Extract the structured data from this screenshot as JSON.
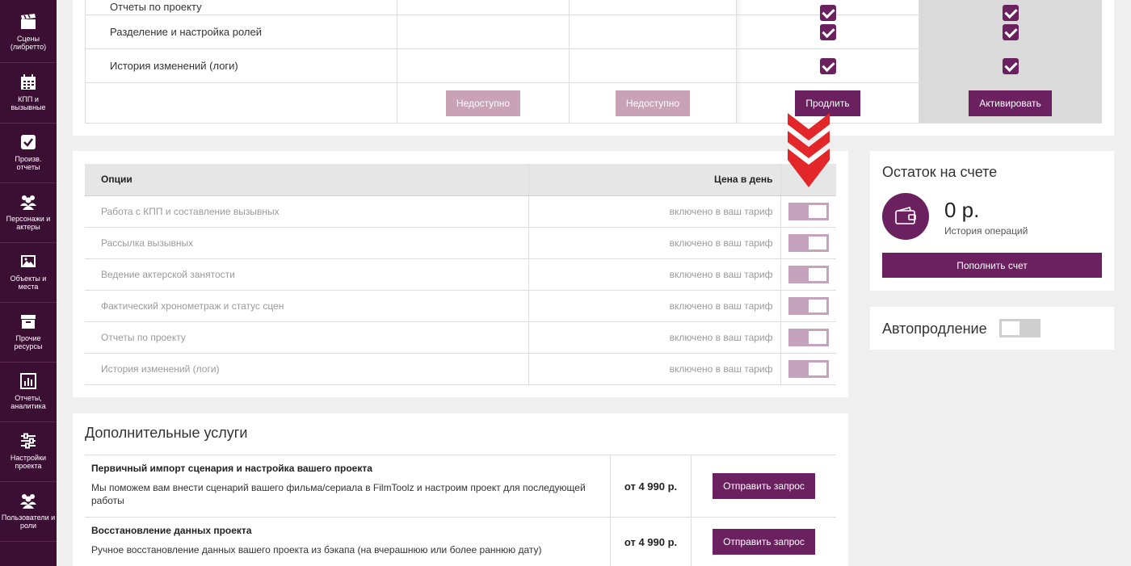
{
  "sidebar": {
    "items": [
      {
        "label": "Сцены\n(либретто)",
        "icon": "clapperboard-icon"
      },
      {
        "label": "КПП и\nвызывные",
        "icon": "calendar-icon"
      },
      {
        "label": "Произв.\nотчеты",
        "icon": "checkbox-icon"
      },
      {
        "label": "Персонажи и\nактеры",
        "icon": "people-icon"
      },
      {
        "label": "Объекты и\nместа",
        "icon": "image-icon"
      },
      {
        "label": "Прочие\nресурсы",
        "icon": "box-icon"
      },
      {
        "label": "Отчеты,\nаналитика",
        "icon": "chart-icon"
      },
      {
        "label": "Настройки\nпроекта",
        "icon": "sliders-icon"
      },
      {
        "label": "Пользователи и\nроли",
        "icon": "users-icon"
      }
    ]
  },
  "tariff_table": {
    "rows": [
      {
        "label": "Отчеты по проекту"
      },
      {
        "label": "Разделение и настройка ролей"
      },
      {
        "label": "История изменений (логи)"
      }
    ],
    "buttons": {
      "col2": "Недоступно",
      "col3": "Недоступно",
      "col4": "Продлить",
      "col5": "Активировать"
    }
  },
  "options": {
    "header": {
      "name": "Опции",
      "price": "Цена в день"
    },
    "rows": [
      {
        "name": "Работа с КПП и составление вызывных",
        "price": "включено в ваш тариф"
      },
      {
        "name": "Рассылка вызывных",
        "price": "включено в ваш тариф"
      },
      {
        "name": "Ведение актерской занятости",
        "price": "включено в ваш тариф"
      },
      {
        "name": "Фактический хронометраж и статус сцен",
        "price": "включено в ваш тариф"
      },
      {
        "name": "Отчеты по проекту",
        "price": "включено в ваш тариф"
      },
      {
        "name": "История изменений (логи)",
        "price": "включено в ваш тариф"
      }
    ]
  },
  "balance": {
    "title": "Остаток на счете",
    "amount": "0 р.",
    "history_link": "История операций",
    "topup_button": "Пополнить счет"
  },
  "autorenew": {
    "label": "Автопродление",
    "enabled": false
  },
  "services": {
    "title": "Дополнительные услуги",
    "items": [
      {
        "name": "Первичный импорт сценария и настройка вашего проекта",
        "desc": "Мы поможем вам внести сценарий вашего фильма/сериала в FilmToolz и настроим проект для последующей работы",
        "price": "от 4 990 р.",
        "button": "Отправить запрос"
      },
      {
        "name": "Восстановление данных проекта",
        "desc": "Ручное восстановление данных вашего проекта из бэкапа (на вчерашнюю или более раннюю дату)",
        "price": "от 4 990 р.",
        "button": "Отправить запрос"
      }
    ]
  },
  "colors": {
    "brand": "#6b2160",
    "sidebar": "#3a0f33",
    "disabled_button": "#c9a2b6",
    "arrow": "#e3262a"
  }
}
